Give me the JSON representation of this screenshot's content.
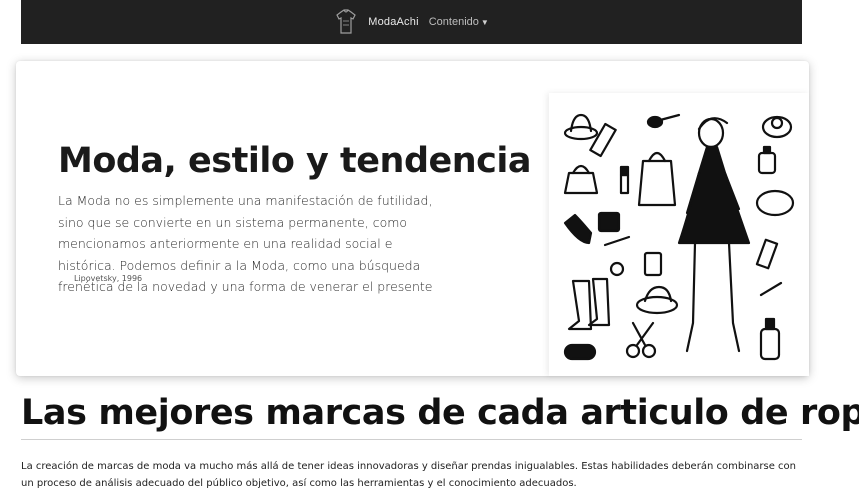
{
  "navbar": {
    "brand": "ModaAchi",
    "dropdown_label": "Contenido",
    "caret": "▼",
    "logo_icon": "clothing-logo-icon",
    "background": "#212121"
  },
  "hero": {
    "title": "Moda, estilo y tendencia",
    "text": "La Moda no es simplemente una manifestación de futilidad, sino que se convierte en un sistema permanente, como mencionamos anteriormente en una realidad social e histórica. Podemos definir a la Moda, como una búsqueda frenética de la novedad y una forma de venerar el presente",
    "citation": "Lipovetsky, 1996",
    "image_icon": "fashion-illustration-icon"
  },
  "section": {
    "title": "Las mejores marcas de cada articulo de ropa",
    "text": "La creación de marcas de moda va mucho más allá de tener ideas innovadoras y diseñar prendas inigualables. Estas habilidades deberán combinarse con un proceso de análisis adecuado del público objetivo, así como las herramientas y el conocimiento adecuados."
  }
}
